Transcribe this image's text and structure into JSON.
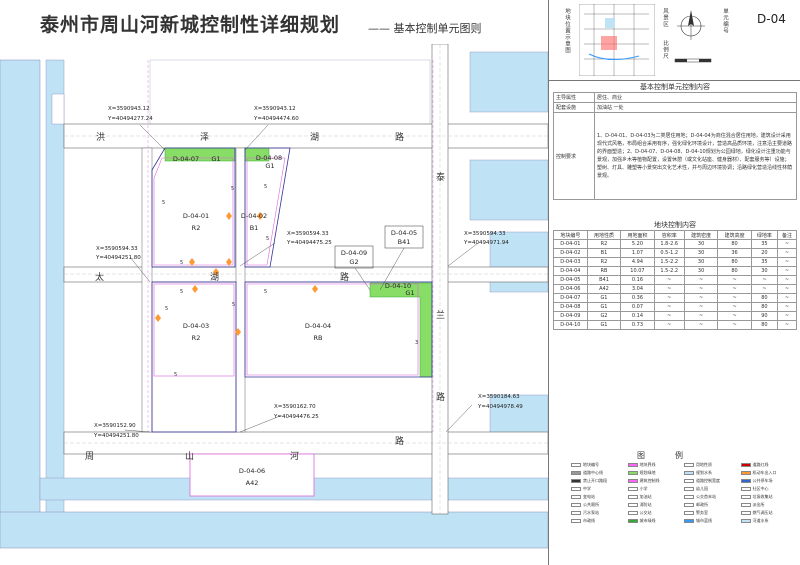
{
  "header": {
    "title": "泰州市周山河新城控制性详细规划",
    "subtitle": "—— 基本控制单元图则"
  },
  "map": {
    "roads": {
      "top": [
        "洪",
        "泽",
        "湖",
        "路"
      ],
      "middle": [
        "太",
        "湖",
        "路"
      ],
      "bottom": [
        "周",
        "山",
        "河",
        "路"
      ],
      "right": [
        "泰",
        "兰",
        "路"
      ]
    },
    "plots": [
      {
        "code": "D-04-07",
        "use": "G1"
      },
      {
        "code": "D-04-08",
        "use": "G1"
      },
      {
        "code": "D-04-01",
        "use": "R2"
      },
      {
        "code": "D-04-02",
        "use": "B1"
      },
      {
        "code": "D-04-09",
        "use": "G2"
      },
      {
        "code": "D-04-05",
        "use": "B41"
      },
      {
        "code": "D-04-10",
        "use": "G1"
      },
      {
        "code": "D-04-03",
        "use": "R2"
      },
      {
        "code": "D-04-04",
        "use": "RB"
      },
      {
        "code": "D-04-06",
        "use": "A42"
      }
    ],
    "coords": [
      {
        "x": "X=3590943.12",
        "y": "Y=40494277.24"
      },
      {
        "x": "X=3590943.12",
        "y": "Y=40494474.60"
      },
      {
        "x": "X=3590594.33",
        "y": "Y=40494475.25"
      },
      {
        "x": "X=3590594.33",
        "y": "Y=40494971.94"
      },
      {
        "x": "X=3590594.33",
        "y": "Y=40494251.80"
      },
      {
        "x": "X=3590184.63",
        "y": "Y=40494978.49"
      },
      {
        "x": "X=3590162.70",
        "y": "Y=40494476.25"
      },
      {
        "x": "X=3590152.90",
        "y": "Y=40494251.80"
      }
    ],
    "setbacks": [
      "5",
      "5",
      "5",
      "5",
      "5",
      "5",
      "5",
      "5",
      "5",
      "5",
      "3"
    ]
  },
  "panel": {
    "minimap_label": "地块位置示意图",
    "location_label": "风景区",
    "location_label2": "比例尺",
    "unit_label": "单元编号",
    "unit_code": "D-04",
    "control_title": "基本控制单元控制内容",
    "control_rows": [
      {
        "k": "主导属性",
        "v": "居住、商业"
      },
      {
        "k": "配套设施",
        "v": "加油站 一处"
      },
      {
        "k": "控制要求",
        "v": "1、D-04-01、D-04-03为二类居住用地；D-04-04为商住混合居住用地，建筑设计采用现代式风格，布局组合采用有序，强化绿化环境设计，营造高品质环境，注意沿主要道路的界面塑造；2、D-04-07、D-04-08、D-04-10规划为公园绿地，绿化设计注重功能与景观，加强乡木等植物配置，设置休憩（或文化站座、健身器材）、配套服务等）设施；塑树、灯具、雕塑等小景突出文化艺术性，并与周边环境协调；沿路绿化营造沿线性林荫景观。"
      }
    ],
    "plot_title": "地块控制内容",
    "plot_headers": [
      "地块编号",
      "用地性质",
      "用地面积",
      "容积率",
      "建筑密度",
      "建筑高度",
      "绿地率",
      "备注"
    ],
    "plot_rows": [
      [
        "D-04-01",
        "R2",
        "5.20",
        "1.8-2.6",
        "30",
        "80",
        "35",
        "~"
      ],
      [
        "D-04-02",
        "B1",
        "1.07",
        "0.5-1.2",
        "30",
        "36",
        "20",
        "~"
      ],
      [
        "D-04-03",
        "R2",
        "4.94",
        "1.5-2.2",
        "30",
        "80",
        "35",
        "~"
      ],
      [
        "D-04-04",
        "RB",
        "10.07",
        "1.5-2.2",
        "30",
        "80",
        "30",
        "~"
      ],
      [
        "D-04-05",
        "B41",
        "0.16",
        "~",
        "~",
        "~",
        "~",
        "~"
      ],
      [
        "D-04-06",
        "A42",
        "3.04",
        "~",
        "~",
        "~",
        "~",
        "~"
      ],
      [
        "D-04-07",
        "G1",
        "0.36",
        "~",
        "~",
        "~",
        "80",
        "~"
      ],
      [
        "D-04-08",
        "G1",
        "0.07",
        "~",
        "~",
        "~",
        "80",
        "~"
      ],
      [
        "D-04-09",
        "G2",
        "0.14",
        "~",
        "~",
        "~",
        "90",
        "~"
      ],
      [
        "D-04-10",
        "G1",
        "0.73",
        "~",
        "~",
        "~",
        "80",
        "~"
      ]
    ],
    "legend_title": "图例",
    "legend": [
      {
        "label": "地块编号",
        "color": "#ffffff"
      },
      {
        "label": "地块界线",
        "color": "#ff66ff"
      },
      {
        "label": "用地性质",
        "color": "#ffffff"
      },
      {
        "label": "道路红线",
        "color": "#cc0000"
      },
      {
        "label": "道路中心线",
        "color": "#999999"
      },
      {
        "label": "规划绿地",
        "color": "#88dd66"
      },
      {
        "label": "规划水系",
        "color": "#bfe3f5"
      },
      {
        "label": "机动车出入口",
        "color": "#ff9933"
      },
      {
        "label": "禁止开口路段",
        "color": "#333333"
      },
      {
        "label": "建筑控制线",
        "color": "#ff66ff"
      },
      {
        "label": "道路控制宽度",
        "color": "#ffffff"
      },
      {
        "label": "公共停车场",
        "color": "#3366cc"
      },
      {
        "label": "中学",
        "color": "#ffffff"
      },
      {
        "label": "小学",
        "color": "#ffffff"
      },
      {
        "label": "幼儿园",
        "color": "#ffffff"
      },
      {
        "label": "社区中心",
        "color": "#ffffff"
      },
      {
        "label": "变电站",
        "color": "#ffffff"
      },
      {
        "label": "加油站",
        "color": "#ffffff"
      },
      {
        "label": "公交首末站",
        "color": "#ffffff"
      },
      {
        "label": "垃圾收集站",
        "color": "#ffffff"
      },
      {
        "label": "公共厕所",
        "color": "#ffffff"
      },
      {
        "label": "消防站",
        "color": "#ffffff"
      },
      {
        "label": "邮政所",
        "color": "#ffffff"
      },
      {
        "label": "派出所",
        "color": "#ffffff"
      },
      {
        "label": "污水泵站",
        "color": "#ffffff"
      },
      {
        "label": "公交站",
        "color": "#ffffff"
      },
      {
        "label": "警务室",
        "color": "#ffffff"
      },
      {
        "label": "燃气调压站",
        "color": "#ffffff"
      },
      {
        "label": "市政线",
        "color": "#ffffff"
      },
      {
        "label": "城市绿线",
        "color": "#33aa33"
      },
      {
        "label": "城市蓝线",
        "color": "#3399ff"
      },
      {
        "label": "河道水系",
        "color": "#bfe3f5"
      }
    ]
  },
  "colors": {
    "road": "#ffffff",
    "water": "#bfe3f5",
    "plot_line": "#dd66dd",
    "green": "#88dd66",
    "block_line": "#333399",
    "entrance": "#ff9933"
  }
}
